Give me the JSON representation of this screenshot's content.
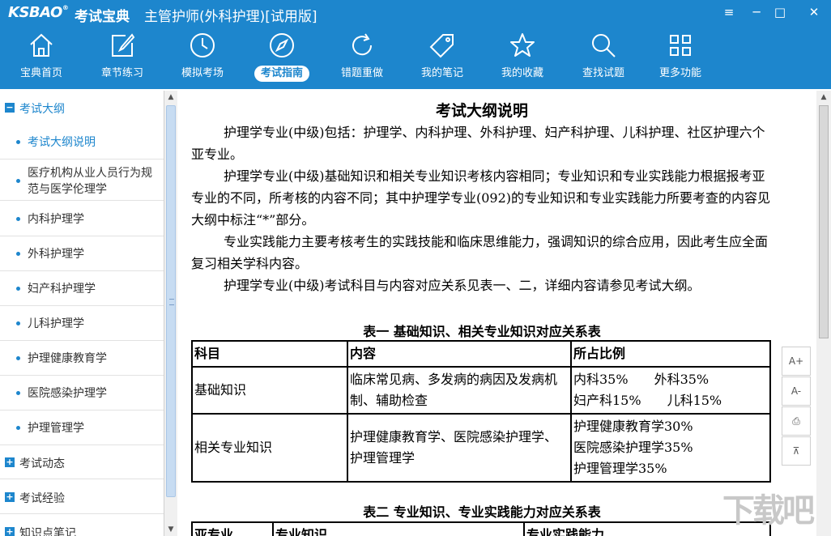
{
  "titlebar": {
    "logo": "KSBAO",
    "logo_reg": "®",
    "brand": "考试宝典",
    "title": "主管护师(外科护理)[试用版]",
    "menu_icon": "≡",
    "minimize_icon": "─",
    "maximize_icon": "□",
    "close_icon": "✕"
  },
  "nav": [
    {
      "label": "宝典首页",
      "icon": "home-icon"
    },
    {
      "label": "章节练习",
      "icon": "edit-icon"
    },
    {
      "label": "模拟考场",
      "icon": "clock-icon"
    },
    {
      "label": "考试指南",
      "icon": "compass-icon",
      "active": true
    },
    {
      "label": "错题重做",
      "icon": "refresh-icon"
    },
    {
      "label": "我的笔记",
      "icon": "tag-icon"
    },
    {
      "label": "我的收藏",
      "icon": "star-icon"
    },
    {
      "label": "查找试题",
      "icon": "search-icon"
    },
    {
      "label": "更多功能",
      "icon": "grid-icon"
    }
  ],
  "sidebar": {
    "categories": [
      {
        "label": "考试大纲",
        "toggle": "−",
        "open": true
      },
      {
        "label": "考试动态",
        "toggle": "+"
      },
      {
        "label": "考试经验",
        "toggle": "+"
      },
      {
        "label": "知识点笔记",
        "toggle": "+"
      }
    ],
    "items": [
      {
        "label": "考试大纲说明",
        "active": true
      },
      {
        "label": "医疗机构从业人员行为规范与医学伦理学"
      },
      {
        "label": "内科护理学"
      },
      {
        "label": "外科护理学"
      },
      {
        "label": "妇产科护理学"
      },
      {
        "label": "儿科护理学"
      },
      {
        "label": "护理健康教育学"
      },
      {
        "label": "医院感染护理学"
      },
      {
        "label": "护理管理学"
      }
    ]
  },
  "doc": {
    "title": "考试大纲说明",
    "paragraphs": [
      "护理学专业(中级)包括：护理学、内科护理、外科护理、妇产科护理、儿科护理、社区护理六个亚专业。",
      "护理学专业(中级)基础知识和相关专业知识考核内容相同；专业知识和专业实践能力根据报考亚专业的不同，所考核的内容不同；其中护理学专业(092)的专业知识和专业实践能力所要考查的内容见大纲中标注“*”部分。",
      "专业实践能力主要考核考生的实践技能和临床思维能力，强调知识的综合应用，因此考生应全面复习相关学科内容。",
      "护理学专业(中级)考试科目与内容对应关系见表一、二，详细内容请参见考试大纲。"
    ],
    "table1": {
      "caption": "表一 基础知识、相关专业知识对应关系表",
      "headers": [
        "科目",
        "内容",
        "所占比例"
      ],
      "rows": [
        [
          "基础知识",
          "临床常见病、多发病的病因及发病机制、辅助检查",
          "内科35%　　外科35%\n妇产科15%　　儿科15%"
        ],
        [
          "相关专业知识",
          "护理健康教育学、医院感染护理学、护理管理学",
          "护理健康教育学30%\n医院感染护理学35%\n护理管理学35%"
        ]
      ]
    },
    "table2": {
      "caption": "表二 专业知识、专业实践能力对应关系表",
      "headers": [
        "亚专业",
        "专业知识",
        "专业实践能力"
      ]
    }
  },
  "tools": [
    {
      "label": "A+"
    },
    {
      "label": "A-"
    },
    {
      "label": "⎙"
    },
    {
      "label": "⊼"
    }
  ],
  "scroll": {
    "up": "▲",
    "down": "▼"
  },
  "watermark": "下载吧",
  "colors": {
    "accent": "#1d86cd"
  }
}
